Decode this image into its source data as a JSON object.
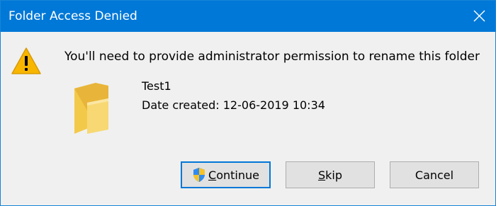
{
  "window": {
    "title": "Folder Access Denied"
  },
  "message": "You'll need to provide administrator permission to rename this folder",
  "item": {
    "name": "Test1",
    "date_created": "Date created: 12-06-2019 10:34"
  },
  "buttons": {
    "continue_label_first": "C",
    "continue_label_rest": "ontinue",
    "skip_label_first": "S",
    "skip_label_rest": "kip",
    "cancel_label": "Cancel"
  },
  "icons": {
    "close": "close-icon",
    "warning": "warning-icon",
    "folder": "folder-icon",
    "shield": "uac-shield-icon"
  },
  "colors": {
    "titlebar": "#0078d7",
    "dialog_bg": "#f0f0f0",
    "button_bg": "#e1e1e1",
    "default_button_border": "#0078d7",
    "warning_fill": "#f8b600"
  }
}
